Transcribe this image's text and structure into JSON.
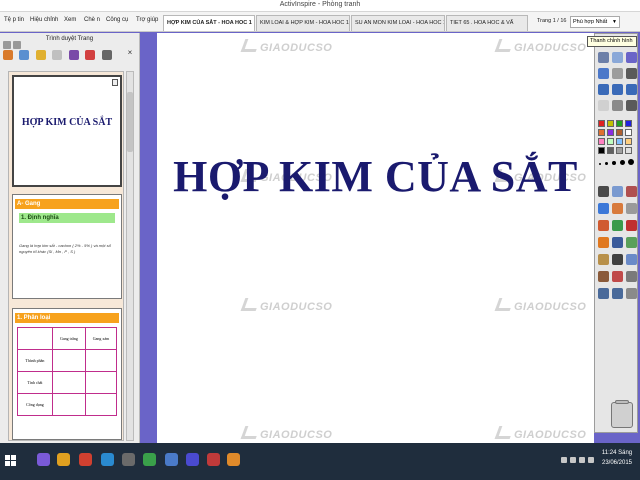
{
  "app": {
    "window_title": "ActivInspire - Phòng tranh"
  },
  "menu": [
    "Tệ p tin",
    "Hiệu chỉnh",
    "Xem",
    "Chè n",
    "Công cụ",
    "Trợ giúp"
  ],
  "tabs": [
    {
      "label": "HỢP KIM CỦA SẮT - HOA HOC 1"
    },
    {
      "label": "KIM LOAI & HỢP KIM - HOA HOC 12"
    },
    {
      "label": "SU AN MON KIM LOAI - HOA HOC 1"
    },
    {
      "label": "TIET 65 . HOA HOC & VẤ"
    }
  ],
  "page_counter": "Trang 1 / 16",
  "fit_select": "Phù hợp Nhất",
  "tooltip": "Thanh chỉnh hình",
  "left_panel": {
    "title": "Trình duyệt Trang",
    "thumb1_title": "HỢP KIM CỦA SẮT",
    "thumb2": {
      "header": "A- Gang",
      "sub": "1. Định nghĩa",
      "note": "Gang là hợp kim sắt - cacbon ( 2% - 5% ) và một số nguyên tố khác (Si , Mn , P , S )"
    },
    "thumb3": {
      "header": "1. Phân loại",
      "col1": "Gang trắng",
      "col2": "Gang xám",
      "rows": [
        "Thành phần",
        "Tính chất",
        "Công dụng"
      ]
    }
  },
  "canvas": {
    "title": "HỢP KIM CỦA SẮT",
    "watermark": "GIAODUCSO"
  },
  "colors": {
    "accent": "#6a64c8",
    "title": "#1a1a6e",
    "orange": "#f7a21d",
    "green": "#9ee88c",
    "palette": [
      "#e02020",
      "#c0c000",
      "#20a020",
      "#2020e0",
      "#e07030",
      "#8a2be2",
      "#b06030",
      "#ffffff",
      "#ff80c0",
      "#c0ffc0",
      "#80c0ff",
      "#ffd080",
      "#000000",
      "#606060",
      "#a0a0a0",
      "#e0e0e0"
    ]
  },
  "taskbar": {
    "time": "11:24 Sáng",
    "date": "23/06/2015"
  }
}
